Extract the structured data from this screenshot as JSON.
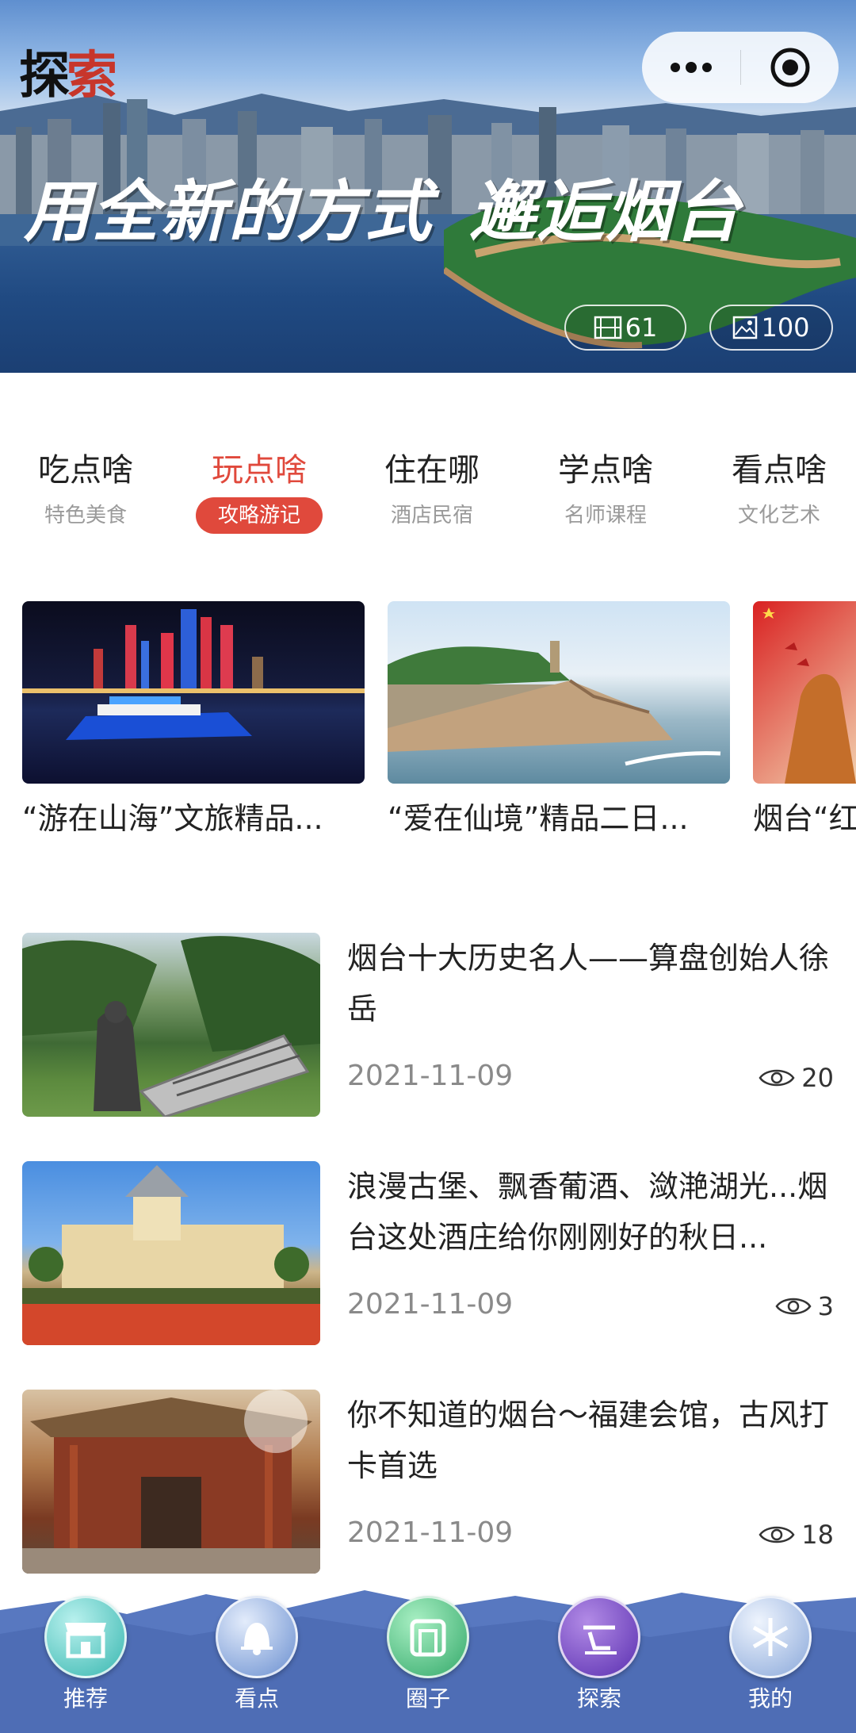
{
  "hero": {
    "brand_part1": "探",
    "brand_part2": "索",
    "slogan_left": "用全新的方式",
    "slogan_right": "邂逅烟台",
    "video_count": "61",
    "photo_count": "100"
  },
  "capsule": {
    "more_icon": "more-dots-icon",
    "close_icon": "target-close-icon"
  },
  "categories": [
    {
      "main": "吃点啥",
      "sub": "特色美食",
      "active": false
    },
    {
      "main": "玩点啥",
      "sub": "攻略游记",
      "active": true
    },
    {
      "main": "住在哪",
      "sub": "酒店民宿",
      "active": false
    },
    {
      "main": "学点啥",
      "sub": "名师课程",
      "active": false
    },
    {
      "main": "看点啥",
      "sub": "文化艺术",
      "active": false
    }
  ],
  "carousel": [
    {
      "caption": "“游在山海”文旅精品..."
    },
    {
      "caption": "“爱在仙境”精品二日..."
    },
    {
      "caption": "烟台“红"
    }
  ],
  "articles": [
    {
      "title": "烟台十大历史名人——算盘创始人徐岳",
      "date": "2021-11-09",
      "views": "20"
    },
    {
      "title": "浪漫古堡、飘香葡酒、潋滟湖光...烟台这处酒庄给你刚刚好的秋日...",
      "date": "2021-11-09",
      "views": "3"
    },
    {
      "title": "你不知道的烟台～福建会馆，古风打卡首选",
      "date": "2021-11-09",
      "views": "18"
    }
  ],
  "tabbar": [
    {
      "label": "推荐",
      "icon": "store-icon"
    },
    {
      "label": "看点",
      "icon": "bell-icon"
    },
    {
      "label": "圈子",
      "icon": "gate-icon"
    },
    {
      "label": "探索",
      "icon": "explore-icon"
    },
    {
      "label": "我的",
      "icon": "snowflake-icon"
    }
  ],
  "colors": {
    "accent": "#e0493c",
    "tabbar_bg": "#5878c0"
  }
}
